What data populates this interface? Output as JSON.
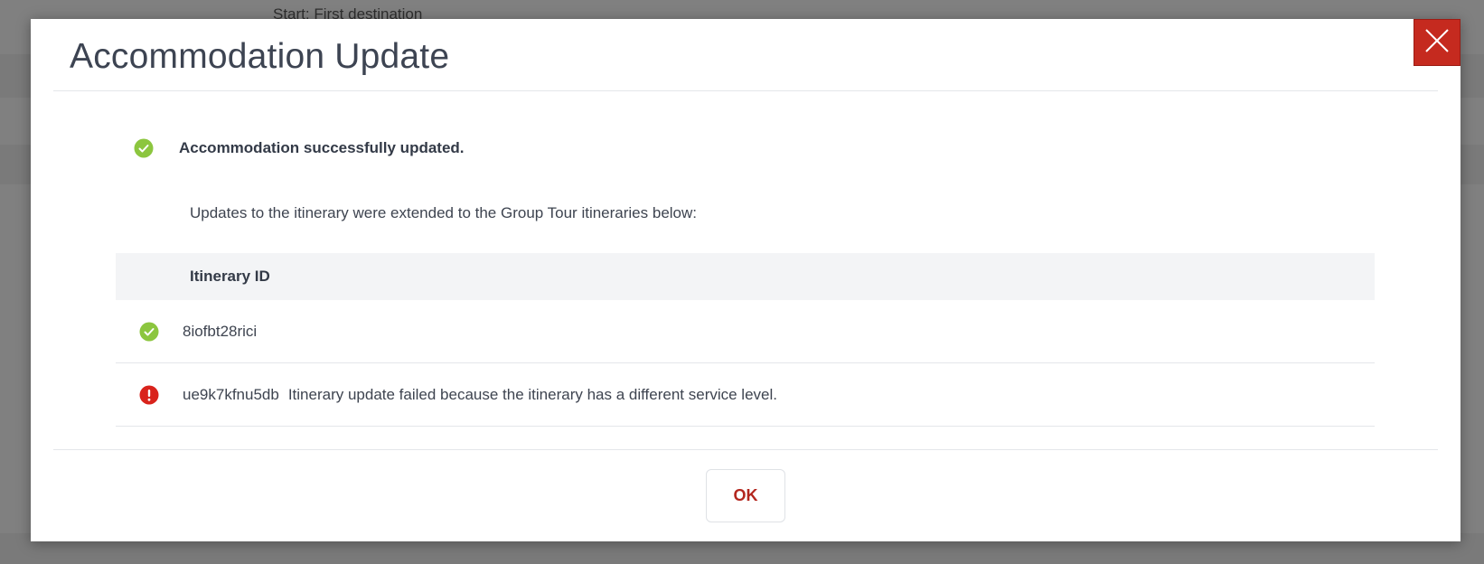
{
  "background": {
    "partial_text": "Start: First destination"
  },
  "modal": {
    "title": "Accommodation Update",
    "close_icon": "close-icon",
    "success_icon": "check-circle-icon",
    "error_icon": "exclamation-circle-icon",
    "success_message": "Accommodation successfully updated.",
    "description": "Updates to the itinerary were extended to the Group Tour itineraries below:",
    "table": {
      "header": "Itinerary ID",
      "rows": [
        {
          "status": "success",
          "id": "8iofbt28rici",
          "message": ""
        },
        {
          "status": "error",
          "id": "ue9k7kfnu5db",
          "message": "Itinerary update failed because the itinerary has a different service level."
        }
      ]
    },
    "ok_label": "OK"
  },
  "colors": {
    "success": "#8cc63f",
    "error": "#d9231c",
    "close_bg": "#c52a1f",
    "ok_text": "#b3261e",
    "title": "#3d4452"
  }
}
